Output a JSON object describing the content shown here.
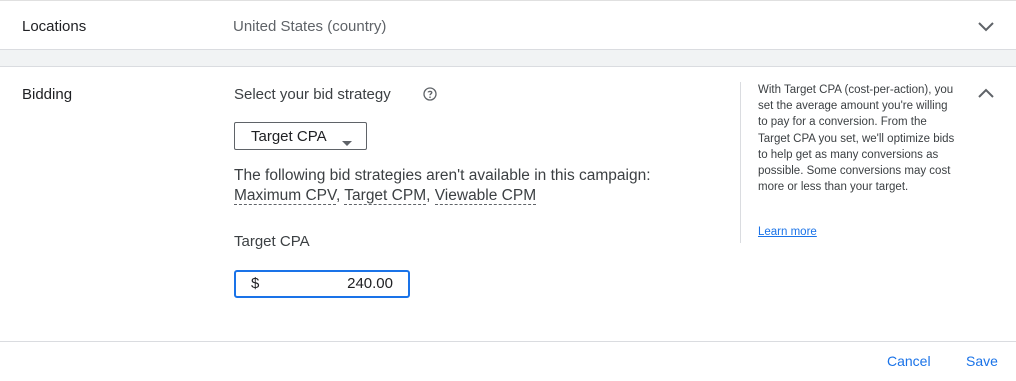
{
  "locations": {
    "label": "Locations",
    "value": "United States (country)",
    "icon": "chevron-down-icon"
  },
  "bidding": {
    "label": "Bidding",
    "title": "Select your bid strategy",
    "help_icon": "help-circle-icon",
    "strategy_selected": "Target CPA",
    "unavailable_text": "The following bid strategies aren't available in this campaign:",
    "unavailable_list": [
      "Maximum CPV",
      "Target CPM",
      "Viewable CPM"
    ],
    "target_cpa_label": "Target CPA",
    "currency_symbol": "$",
    "target_cpa_value": "240.00",
    "collapse_icon": "chevron-up-icon",
    "help_panel": {
      "text": "With Target CPA (cost-per-action), you set the average amount you're willing to pay for a conversion. From the Target CPA you set, we'll optimize bids to help get as many conversions as possible. Some conversions may cost more or less than your target.",
      "link": "Learn more"
    }
  },
  "footer": {
    "cancel_label": "Cancel",
    "save_label": "Save"
  },
  "colors": {
    "accent": "#1a73e8",
    "text": "#3c4043",
    "divider": "#dadce0",
    "gap": "#f1f3f4"
  }
}
